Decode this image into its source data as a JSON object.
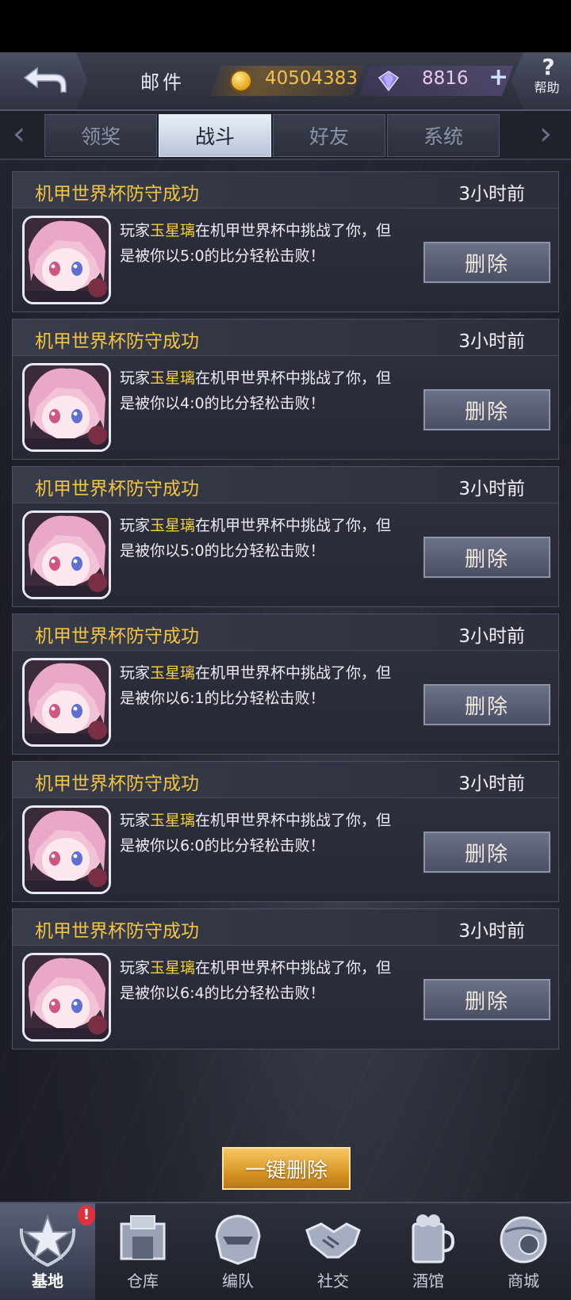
{
  "header": {
    "title": "邮件",
    "gold": "40504383",
    "gems": "8816",
    "plus": "+",
    "help_label": "帮助",
    "help_glyph": "?"
  },
  "tabs": [
    {
      "label": "领奖",
      "active": false
    },
    {
      "label": "战斗",
      "active": true
    },
    {
      "label": "好友",
      "active": false
    },
    {
      "label": "系统",
      "active": false
    }
  ],
  "tab_arrows": {
    "left": "‹",
    "right": "›"
  },
  "mails": [
    {
      "title": "机甲世界杯防守成功",
      "time": "3小时前",
      "prefix": "玩家",
      "player": "玉星璃",
      "line1_rest": "在机甲世界杯中挑战了你，但",
      "line2": "是被你以5:0的比分轻松击败！",
      "delete_label": "删除"
    },
    {
      "title": "机甲世界杯防守成功",
      "time": "3小时前",
      "prefix": "玩家",
      "player": "玉星璃",
      "line1_rest": "在机甲世界杯中挑战了你，但",
      "line2": "是被你以4:0的比分轻松击败！",
      "delete_label": "删除"
    },
    {
      "title": "机甲世界杯防守成功",
      "time": "3小时前",
      "prefix": "玩家",
      "player": "玉星璃",
      "line1_rest": "在机甲世界杯中挑战了你，但",
      "line2": "是被你以5:0的比分轻松击败！",
      "delete_label": "删除"
    },
    {
      "title": "机甲世界杯防守成功",
      "time": "3小时前",
      "prefix": "玩家",
      "player": "玉星璃",
      "line1_rest": "在机甲世界杯中挑战了你，但",
      "line2": "是被你以6:1的比分轻松击败！",
      "delete_label": "删除"
    },
    {
      "title": "机甲世界杯防守成功",
      "time": "3小时前",
      "prefix": "玩家",
      "player": "玉星璃",
      "line1_rest": "在机甲世界杯中挑战了你，但",
      "line2": "是被你以6:0的比分轻松击败！",
      "delete_label": "删除"
    },
    {
      "title": "机甲世界杯防守成功",
      "time": "3小时前",
      "prefix": "玩家",
      "player": "玉星璃",
      "line1_rest": "在机甲世界杯中挑战了你，但",
      "line2": "是被你以6:4的比分轻松击败！",
      "delete_label": "删除"
    }
  ],
  "delete_all_label": "一键删除",
  "nav": {
    "badge": "!",
    "items": [
      {
        "label": "基地",
        "icon": "base-star-icon",
        "active": true
      },
      {
        "label": "仓库",
        "icon": "warehouse-icon",
        "active": false
      },
      {
        "label": "编队",
        "icon": "mech-head-icon",
        "active": false
      },
      {
        "label": "社交",
        "icon": "handshake-icon",
        "active": false
      },
      {
        "label": "酒馆",
        "icon": "tavern-icon",
        "active": false
      },
      {
        "label": "商城",
        "icon": "shop-sphere-icon",
        "active": false
      }
    ]
  },
  "colors": {
    "accent_gold": "#f3c542",
    "player_highlight": "#f4d23a",
    "badge_red": "#e0303a"
  }
}
